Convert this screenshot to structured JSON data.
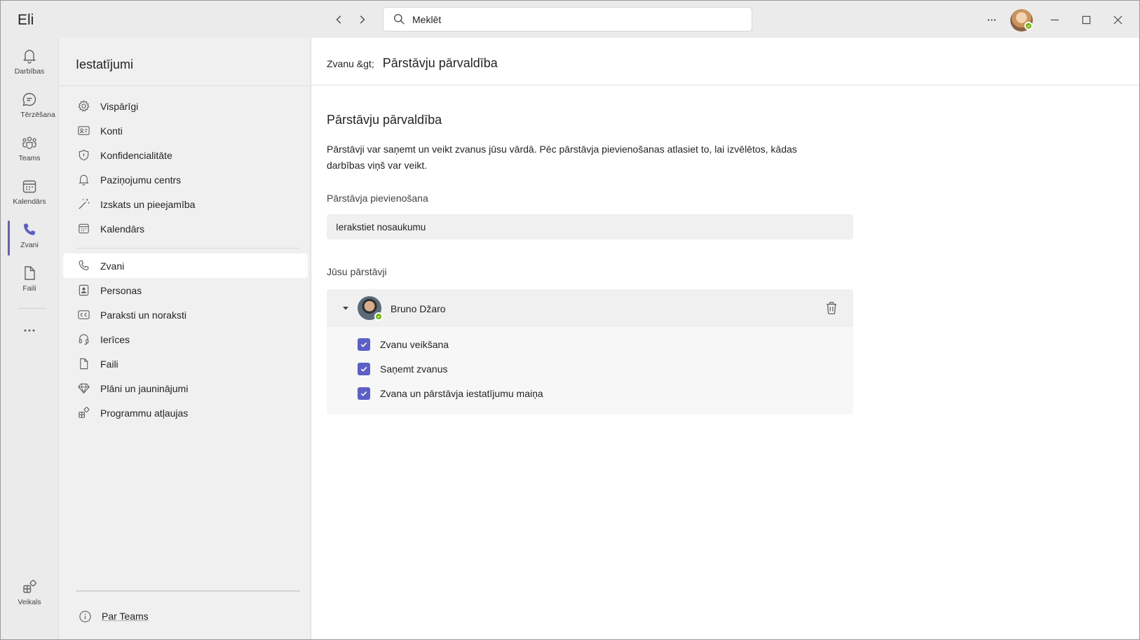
{
  "titlebar": {
    "app_name": "Eli",
    "search_placeholder": "Meklēt"
  },
  "rail": [
    {
      "label": "Darbības",
      "icon": "bell-icon"
    },
    {
      "label": "Tērzēšana",
      "icon": "chat-icon"
    },
    {
      "label": "Teams",
      "icon": "teams-icon"
    },
    {
      "label": "Kalendārs",
      "icon": "calendar-icon"
    },
    {
      "label": "Zvani",
      "icon": "phone-icon",
      "active": true
    },
    {
      "label": "Faili",
      "icon": "file-icon"
    },
    {
      "label": "Veikals",
      "icon": "apps-icon"
    }
  ],
  "settings": {
    "title": "Iestatījumi",
    "items": [
      {
        "label": "Vispārīgi",
        "icon": "gear-icon"
      },
      {
        "label": "Konti",
        "icon": "contact-card-icon"
      },
      {
        "label": "Konfidencialitāte",
        "icon": "shield-icon"
      },
      {
        "label": "Paziņojumu centrs",
        "icon": "bell-icon"
      },
      {
        "label": "Izskats un pieejamība",
        "icon": "wand-icon"
      },
      {
        "label": "Kalendārs",
        "icon": "calendar-icon"
      },
      {
        "label": "Zvani",
        "icon": "phone-icon",
        "selected": true
      },
      {
        "label": "Personas",
        "icon": "person-icon"
      },
      {
        "label": "Paraksti un noraksti",
        "icon": "cc-icon"
      },
      {
        "label": "Ierīces",
        "icon": "headset-icon"
      },
      {
        "label": "Faili",
        "icon": "file-icon"
      },
      {
        "label": "Plāni un jauninājumi",
        "icon": "diamond-icon"
      },
      {
        "label": "Programmu atļaujas",
        "icon": "apps-icon"
      }
    ],
    "about": "Par Teams"
  },
  "main": {
    "breadcrumb_parent": "Zvanu &gt;",
    "breadcrumb_current": "Pārstāvju pārvaldība",
    "section_title": "Pārstāvju pārvaldība",
    "description": "Pārstāvji var saņemt un veikt zvanus jūsu vārdā. Pēc pārstāvja pievienošanas atlasiet to, lai izvēlētos, kādas darbības viņš var veikt.",
    "add_label": "Pārstāvja pievienošana",
    "add_placeholder": "Ierakstiet nosaukumu",
    "delegates_label": "Jūsu pārstāvji",
    "delegate": {
      "name": "Bruno Džaro",
      "permissions": [
        {
          "label": "Zvanu veikšana",
          "checked": true
        },
        {
          "label": "Saņemt zvanus",
          "checked": true
        },
        {
          "label": "Zvana un pārstāvja iestatījumu maiņa",
          "checked": true
        }
      ]
    }
  },
  "colors": {
    "accent": "#5b5fc7",
    "presence_available": "#6bb700"
  }
}
